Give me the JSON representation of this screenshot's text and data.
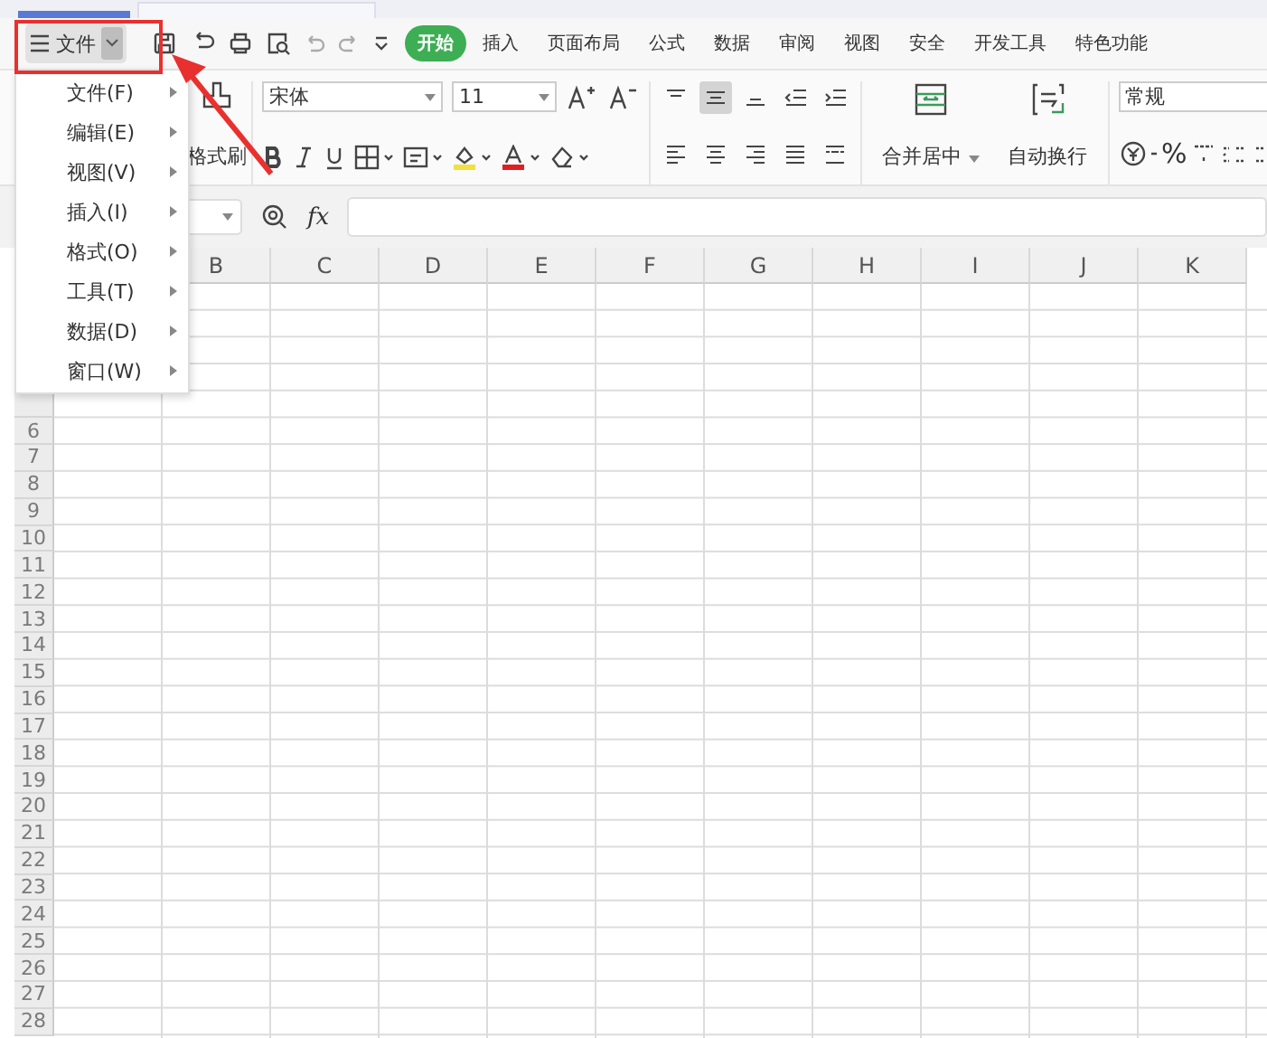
{
  "menu_button": {
    "label": "文件",
    "expanded": true
  },
  "ribbon_tabs": [
    {
      "label": "开始",
      "selected": true
    },
    {
      "label": "插入",
      "selected": false
    },
    {
      "label": "页面布局",
      "selected": false
    },
    {
      "label": "公式",
      "selected": false
    },
    {
      "label": "数据",
      "selected": false
    },
    {
      "label": "审阅",
      "selected": false
    },
    {
      "label": "视图",
      "selected": false
    },
    {
      "label": "安全",
      "selected": false
    },
    {
      "label": "开发工具",
      "selected": false
    },
    {
      "label": "特色功能",
      "selected": false
    }
  ],
  "ribbon": {
    "format_painter": "格式刷",
    "font": "宋体",
    "font_size": "11",
    "merge": "合并居中",
    "wrap": "自动换行",
    "number_format": "常规",
    "percent": "%",
    "align_top": [
      {
        "kind": "top",
        "selected": false
      },
      {
        "kind": "middle",
        "selected": true
      },
      {
        "kind": "bottom",
        "selected": false
      },
      {
        "kind": "outdent",
        "selected": false
      },
      {
        "kind": "indent",
        "selected": false
      }
    ],
    "align_bottom": [
      {
        "kind": "left",
        "selected": false
      },
      {
        "kind": "center",
        "selected": false
      },
      {
        "kind": "right",
        "selected": false
      },
      {
        "kind": "justify",
        "selected": false
      },
      {
        "kind": "distribute",
        "selected": false
      }
    ]
  },
  "formula_bar": {
    "fx": "fx"
  },
  "menu": [
    {
      "label": "文件(F)"
    },
    {
      "label": "编辑(E)"
    },
    {
      "label": "视图(V)"
    },
    {
      "label": "插入(I)"
    },
    {
      "label": "格式(O)"
    },
    {
      "label": "工具(T)"
    },
    {
      "label": "数据(D)"
    },
    {
      "label": "窗口(W)"
    }
  ],
  "sheet": {
    "columns": [
      "B",
      "C",
      "D",
      "E",
      "F",
      "G",
      "H",
      "I",
      "J",
      "K"
    ],
    "rows": [
      "6",
      "7",
      "8",
      "9",
      "10",
      "11",
      "12",
      "13",
      "14",
      "15",
      "16",
      "17",
      "18",
      "19",
      "20",
      "21",
      "22",
      "23",
      "24",
      "25",
      "26",
      "27",
      "28"
    ]
  },
  "annotation": {
    "highlight": true
  }
}
